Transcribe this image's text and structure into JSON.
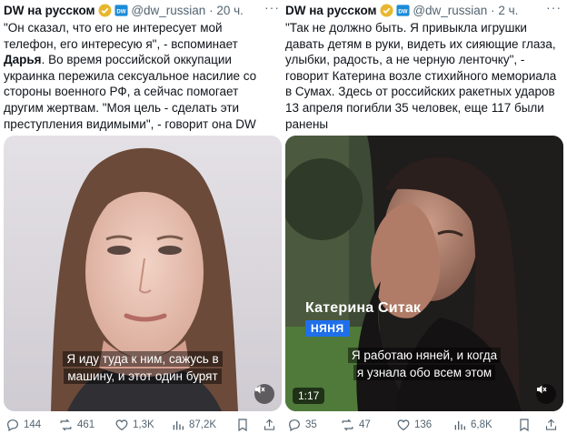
{
  "left_tweet": {
    "author_name": "DW на русском",
    "handle": "@dw_russian",
    "time": "20 ч.",
    "text_part1": "\"Он сказал, что его не интересует мой телефон, его интересую я\", - вспоминает ",
    "text_bold": "Дарья",
    "text_part2": ". Во время российской оккупации украинка пережила сексуальное насилие со стороны военного РФ, а сейчас помогает другим жертвам. \"Моя цель - сделать эти преступления видимыми\", - говорит она DW",
    "caption_line1": "Я иду туда к ним, сажусь в",
    "caption_line2": "машину, и этот один бурят",
    "stats": {
      "replies": "144",
      "reposts": "461",
      "likes": "1,3K",
      "views": "87,2K"
    }
  },
  "right_tweet": {
    "author_name": "DW на русском",
    "handle": "@dw_russian",
    "time": "2 ч.",
    "text": "\"Так не должно быть. Я привыкла игрушки давать детям в руки, видеть их сияющие глаза, улыбки, радость, а не черную ленточку\", - говорит Катерина возле стихийного мемориала в Сумах. Здесь от российских ракетных ударов 13 апреля погибли 35 человек, еще 117 были ранены",
    "lower_third_name": "Катерина Ситак",
    "lower_third_role": "НЯНЯ",
    "caption_line1": "Я работаю няней, и когда",
    "caption_line2": "я узнала обо всем этом",
    "duration": "1:17",
    "stats": {
      "replies": "35",
      "reposts": "47",
      "likes": "136",
      "views": "6,8K"
    }
  },
  "colors": {
    "text": "#0f1419",
    "muted": "#536471",
    "verified_gold": "#e8b730",
    "role_blue": "#1f6feb"
  },
  "icons": [
    "verified-badge-icon",
    "affiliate-badge-icon",
    "more-icon",
    "reply-icon",
    "repost-icon",
    "like-icon",
    "views-icon",
    "bookmark-icon",
    "share-icon",
    "mute-icon"
  ]
}
